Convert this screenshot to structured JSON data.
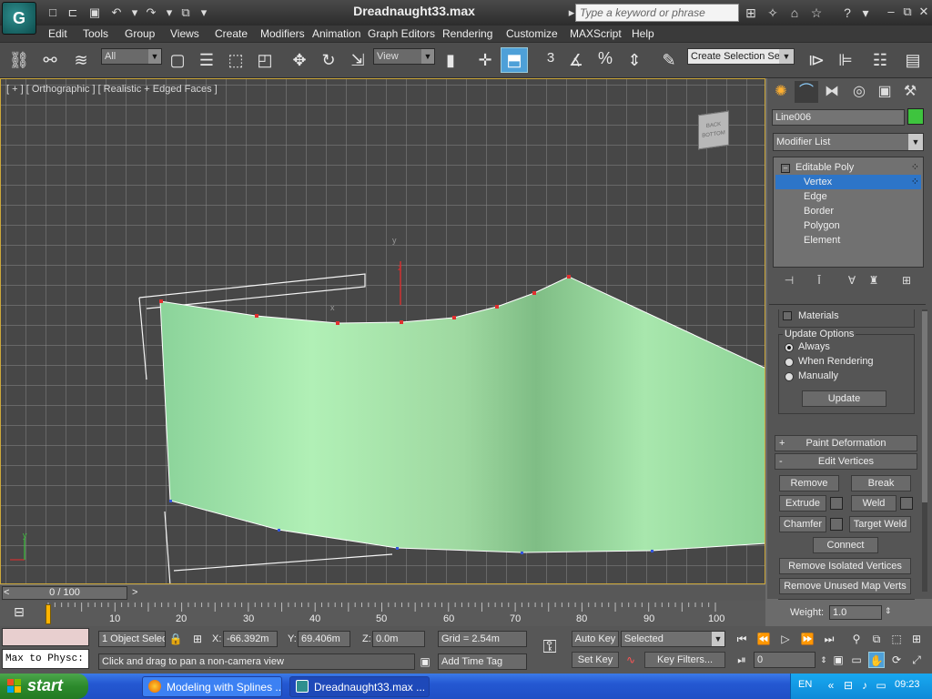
{
  "window": {
    "title": "Dreadnaught33.max",
    "search_placeholder": "Type a keyword or phrase"
  },
  "menu": [
    "Edit",
    "Tools",
    "Group",
    "Views",
    "Create",
    "Modifiers",
    "Animation",
    "Graph Editors",
    "Rendering",
    "Customize",
    "MAXScript",
    "Help"
  ],
  "toolbar": {
    "filter_dropdown": "All",
    "refcoord_dropdown": "View",
    "snap_angle_label": "3",
    "snap_percent_label": "%",
    "selection_set": "Create Selection Se"
  },
  "viewport": {
    "label": "[ + ] [ Orthographic ] [ Realistic + Edged Faces ]",
    "viewcube_text": "BACK BOTTOM",
    "gizmo_y": "y",
    "gizmo_z": "z",
    "gizmo_x": "x",
    "corner_y": "y"
  },
  "command_panel": {
    "object_name": "Line006",
    "object_color": "#3ec43e",
    "modifier_list": "Modifier List",
    "stack": [
      {
        "label": "Editable Poly",
        "expander": "⊟"
      },
      {
        "label": "Vertex",
        "selected": true
      },
      {
        "label": "Edge"
      },
      {
        "label": "Border"
      },
      {
        "label": "Polygon"
      },
      {
        "label": "Element"
      }
    ],
    "materials_label": "Materials",
    "update_options": {
      "title": "Update Options",
      "always": "Always",
      "when_rendering": "When Rendering",
      "manually": "Manually",
      "update_button": "Update"
    },
    "paint_deformation": {
      "pm": "+",
      "label": "Paint Deformation"
    },
    "edit_vertices": {
      "pm": "-",
      "label": "Edit Vertices",
      "remove": "Remove",
      "break": "Break",
      "extrude": "Extrude",
      "weld": "Weld",
      "chamfer": "Chamfer",
      "target_weld": "Target Weld",
      "connect": "Connect",
      "remove_isolated": "Remove Isolated Vertices",
      "remove_unused": "Remove Unused Map Verts",
      "weight_label": "Weight:",
      "weight_value": "1.0"
    }
  },
  "timeline": {
    "slider": "0 / 100",
    "prev": "<",
    "next": ">",
    "ticks": [
      "10",
      "20",
      "30",
      "40",
      "50",
      "60",
      "70",
      "80",
      "90",
      "100"
    ]
  },
  "status": {
    "maxscript_text": "Max to Physc:",
    "selection_count": "1 Object Selec",
    "x_label": "X:",
    "x_value": "-66.392m",
    "y_label": "Y:",
    "y_value": "69.406m",
    "z_label": "Z:",
    "z_value": "0.0m",
    "grid": "Grid = 2.54m",
    "prompt": "Click and drag to pan a non-camera view",
    "add_time_tag": "Add Time Tag",
    "auto_key": "Auto Key",
    "set_key": "Set Key",
    "key_mode": "Selected",
    "key_filters": "Key Filters...",
    "frame_value": "0"
  },
  "taskbar": {
    "start": "start",
    "tasks": [
      {
        "label": "Modeling with Splines ..."
      },
      {
        "label": "Dreadnaught33.max ...",
        "active": true
      }
    ],
    "lang": "EN",
    "clock": "09:23"
  },
  "colors": {
    "surface": "#9fe0a0",
    "selection": "#2d75c8",
    "active_tool": "#4ea0d8",
    "vertex": "#e03030"
  }
}
